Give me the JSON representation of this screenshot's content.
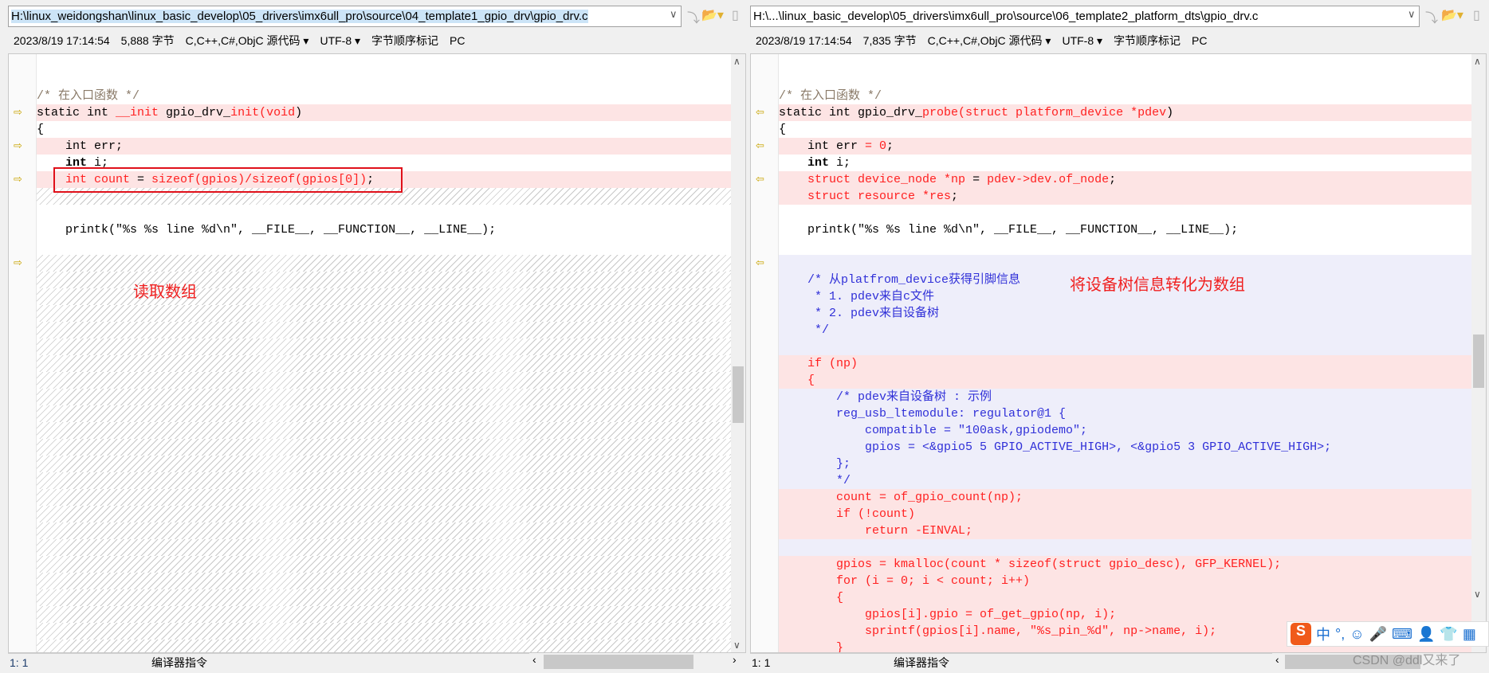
{
  "left": {
    "path": "H:\\linux_weidongshan\\linux_basic_develop\\05_drivers\\imx6ull_pro\\source\\04_template1_gpio_drv\\gpio_drv.c",
    "info": [
      "2023/8/19 17:14:54",
      "5,888 字节",
      "C,C++,C#,ObjC 源代码 ▾",
      "UTF-8 ▾",
      "字节顺序标记",
      "PC"
    ],
    "status": {
      "pos": "1: 1",
      "mode": "编译器指令"
    },
    "rows": [
      {
        "bg": "w",
        "segs": []
      },
      {
        "bg": "w",
        "segs": []
      },
      {
        "bg": "w",
        "segs": [
          [
            "/* 在入口函数 */",
            "cm"
          ]
        ]
      },
      {
        "bg": "p",
        "arrow": true,
        "segs": [
          [
            "static int ",
            "n"
          ],
          [
            "__init",
            "d"
          ],
          [
            " gpio_drv_",
            "n"
          ],
          [
            "init(void",
            "d"
          ],
          [
            ")",
            "n"
          ]
        ]
      },
      {
        "bg": "w",
        "segs": [
          [
            "{",
            "n"
          ]
        ]
      },
      {
        "bg": "p",
        "arrow": true,
        "segs": [
          [
            "    int err;",
            "n"
          ]
        ]
      },
      {
        "bg": "w",
        "segs": [
          [
            "    ",
            "n"
          ],
          [
            "int",
            "b"
          ],
          [
            " i;",
            "n"
          ]
        ]
      },
      {
        "bg": "p",
        "arrow": true,
        "segs": [
          [
            "    ",
            "n"
          ],
          [
            "int count",
            "d"
          ],
          [
            " = ",
            "n"
          ],
          [
            "sizeof(gpios)/sizeof(gpios[0])",
            "d"
          ],
          [
            ";",
            "n"
          ]
        ]
      },
      {
        "bg": "h",
        "segs": []
      },
      {
        "bg": "w",
        "segs": []
      },
      {
        "bg": "w",
        "segs": [
          [
            "    printk(\"%s %s line %d\\n\", __FILE__, __FUNCTION__, __LINE__);",
            "n"
          ]
        ]
      },
      {
        "bg": "w",
        "segs": []
      },
      {
        "bg": "h",
        "arrow": true,
        "segs": []
      },
      {
        "bg": "h",
        "segs": []
      },
      {
        "bg": "h",
        "segs": []
      },
      {
        "bg": "h",
        "segs": []
      },
      {
        "bg": "h",
        "segs": []
      },
      {
        "bg": "h",
        "segs": []
      },
      {
        "bg": "h",
        "segs": []
      },
      {
        "bg": "h",
        "segs": []
      },
      {
        "bg": "h",
        "segs": []
      },
      {
        "bg": "h",
        "segs": []
      },
      {
        "bg": "h",
        "segs": []
      },
      {
        "bg": "h",
        "segs": []
      },
      {
        "bg": "h",
        "segs": []
      },
      {
        "bg": "h",
        "segs": []
      },
      {
        "bg": "h",
        "segs": []
      },
      {
        "bg": "h",
        "segs": []
      },
      {
        "bg": "h",
        "segs": []
      },
      {
        "bg": "h",
        "segs": []
      },
      {
        "bg": "h",
        "segs": []
      },
      {
        "bg": "h",
        "segs": []
      },
      {
        "bg": "h",
        "segs": []
      },
      {
        "bg": "h",
        "segs": []
      },
      {
        "bg": "h",
        "segs": []
      },
      {
        "bg": "h",
        "segs": []
      }
    ]
  },
  "right": {
    "path": "H:\\...\\linux_basic_develop\\05_drivers\\imx6ull_pro\\source\\06_template2_platform_dts\\gpio_drv.c",
    "info": [
      "2023/8/19 17:14:54",
      "7,835 字节",
      "C,C++,C#,ObjC 源代码 ▾",
      "UTF-8 ▾",
      "字节顺序标记",
      "PC"
    ],
    "status": {
      "pos": "1: 1",
      "mode": "编译器指令"
    },
    "rows": [
      {
        "bg": "w",
        "segs": []
      },
      {
        "bg": "w",
        "segs": []
      },
      {
        "bg": "w",
        "segs": [
          [
            "/* 在入口函数 */",
            "cm"
          ]
        ]
      },
      {
        "bg": "p",
        "arrow": true,
        "segs": [
          [
            "static int gpio_drv_",
            "n"
          ],
          [
            "probe(struct platform_device *pdev",
            "d"
          ],
          [
            ")",
            "n"
          ]
        ]
      },
      {
        "bg": "w",
        "segs": [
          [
            "{",
            "n"
          ]
        ]
      },
      {
        "bg": "p",
        "arrow": true,
        "segs": [
          [
            "    int err",
            "n"
          ],
          [
            " = 0",
            "d"
          ],
          [
            ";",
            "n"
          ]
        ]
      },
      {
        "bg": "w",
        "segs": [
          [
            "    ",
            "n"
          ],
          [
            "int",
            "b"
          ],
          [
            " i;",
            "n"
          ]
        ]
      },
      {
        "bg": "p",
        "arrow": true,
        "segs": [
          [
            "    ",
            "n"
          ],
          [
            "struct device_node *np",
            "d"
          ],
          [
            " = ",
            "n"
          ],
          [
            "pdev->dev.of_node",
            "d"
          ],
          [
            ";",
            "n"
          ]
        ]
      },
      {
        "bg": "p",
        "segs": [
          [
            "    ",
            "n"
          ],
          [
            "struct resource *res",
            "d"
          ],
          [
            ";",
            "n"
          ]
        ]
      },
      {
        "bg": "w",
        "segs": []
      },
      {
        "bg": "w",
        "segs": [
          [
            "    printk(\"%s %s line %d\\n\", __FILE__, __FUNCTION__, __LINE__);",
            "n"
          ]
        ]
      },
      {
        "bg": "w",
        "segs": []
      },
      {
        "bg": "l",
        "arrow": true,
        "segs": []
      },
      {
        "bg": "l",
        "segs": [
          [
            "    /* 从platfrom_device获得引脚信息",
            "bl"
          ]
        ]
      },
      {
        "bg": "l",
        "segs": [
          [
            "     * 1. pdev来自c文件",
            "bl"
          ]
        ]
      },
      {
        "bg": "l",
        "segs": [
          [
            "     * 2. pdev来自设备树",
            "bl"
          ]
        ]
      },
      {
        "bg": "l",
        "segs": [
          [
            "     */",
            "bl"
          ]
        ]
      },
      {
        "bg": "l",
        "segs": []
      },
      {
        "bg": "p",
        "segs": [
          [
            "    if (np)",
            "d"
          ]
        ]
      },
      {
        "bg": "p",
        "segs": [
          [
            "    {",
            "d"
          ]
        ]
      },
      {
        "bg": "l",
        "segs": [
          [
            "        /* pdev来自设备树 : 示例",
            "bl"
          ]
        ]
      },
      {
        "bg": "l",
        "segs": [
          [
            "        reg_usb_ltemodule: regulator@1 {",
            "bl"
          ]
        ]
      },
      {
        "bg": "l",
        "segs": [
          [
            "            compatible = \"100ask,gpiodemo\";",
            "bl"
          ]
        ]
      },
      {
        "bg": "l",
        "segs": [
          [
            "            gpios = <&gpio5 5 GPIO_ACTIVE_HIGH>, <&gpio5 3 GPIO_ACTIVE_HIGH>;",
            "bl"
          ]
        ]
      },
      {
        "bg": "l",
        "segs": [
          [
            "        };",
            "bl"
          ]
        ]
      },
      {
        "bg": "l",
        "segs": [
          [
            "        */",
            "bl"
          ]
        ]
      },
      {
        "bg": "p",
        "segs": [
          [
            "        count = of_gpio_count(np);",
            "d"
          ]
        ]
      },
      {
        "bg": "p",
        "segs": [
          [
            "        if (!count)",
            "d"
          ]
        ]
      },
      {
        "bg": "p",
        "segs": [
          [
            "            return -EINVAL;",
            "d"
          ]
        ]
      },
      {
        "bg": "l",
        "segs": []
      },
      {
        "bg": "p",
        "segs": [
          [
            "        gpios = kmalloc(count * sizeof(struct gpio_desc), GFP_KERNEL);",
            "d"
          ]
        ]
      },
      {
        "bg": "p",
        "segs": [
          [
            "        for (i = 0; i < count; i++)",
            "d"
          ]
        ]
      },
      {
        "bg": "p",
        "segs": [
          [
            "        {",
            "d"
          ]
        ]
      },
      {
        "bg": "p",
        "segs": [
          [
            "            gpios[i].gpio = of_get_gpio(np, i);",
            "d"
          ]
        ]
      },
      {
        "bg": "p",
        "segs": [
          [
            "            sprintf(gpios[i].name, \"%s_pin_%d\", np->name, i);",
            "d"
          ]
        ]
      },
      {
        "bg": "p",
        "segs": [
          [
            "        }",
            "d"
          ]
        ]
      }
    ]
  },
  "annotations": {
    "left_note": "读取数组",
    "right_note": "将设备树信息转化为数组"
  },
  "ime": {
    "logo": "S",
    "items": [
      "中",
      "°,",
      "☺",
      "🎤",
      "⌨",
      "👤",
      "👕",
      "▦"
    ]
  },
  "watermark": "CSDN @ddl又来了",
  "colors": {
    "diff_row": "#fde4e4",
    "unmatched_row": "#eeeefa",
    "diff_text": "#ff2020",
    "comment": "#8a7a68",
    "annotation": "#f02020"
  }
}
